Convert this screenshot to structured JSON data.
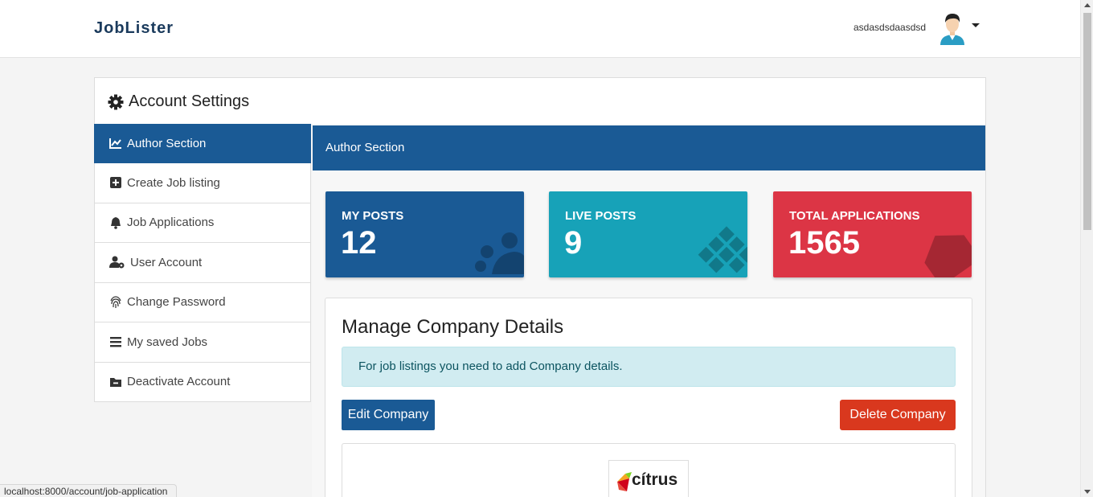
{
  "header": {
    "brand": "JobLister",
    "user_name": "asdasdsdaasdsd"
  },
  "settings": {
    "title": "Account Settings"
  },
  "sidebar": {
    "items": [
      {
        "label": "Author Section",
        "icon": "chart-line-icon",
        "active": true
      },
      {
        "label": "Create Job listing",
        "icon": "plus-square-icon"
      },
      {
        "label": "Job Applications",
        "icon": "bell-icon"
      },
      {
        "label": "User Account",
        "icon": "user-cog-icon"
      },
      {
        "label": "Change Password",
        "icon": "fingerprint-icon"
      },
      {
        "label": "My saved Jobs",
        "icon": "list-icon"
      },
      {
        "label": "Deactivate Account",
        "icon": "folder-minus-icon"
      }
    ]
  },
  "main": {
    "header": "Author Section",
    "stats": [
      {
        "label": "MY POSTS",
        "value": "12",
        "color": "#1a5a95",
        "icon": "users-icon"
      },
      {
        "label": "LIVE POSTS",
        "value": "9",
        "color": "#17a2b8",
        "icon": "th-icon"
      },
      {
        "label": "TOTAL APPLICATIONS",
        "value": "1565",
        "color": "#dc3545",
        "icon": "envelope-icon"
      }
    ],
    "company": {
      "title": "Manage Company Details",
      "alert": "For job listings you need to add Company details.",
      "edit_label": "Edit Company",
      "delete_label": "Delete Company",
      "logo_text": "cítrus"
    }
  },
  "status_bar": {
    "url": "localhost:8000/account/job-application"
  }
}
